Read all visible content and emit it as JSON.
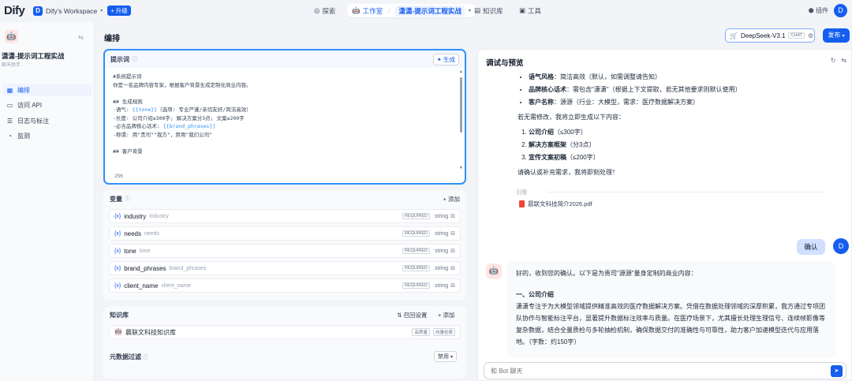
{
  "topbar": {
    "logo": "Dify",
    "workspace_initial": "D",
    "workspace_name": "Dify's Workspace",
    "upgrade_label": "+ 升级",
    "nav_explore": "探索",
    "nav_studio": "工作室",
    "nav_app": "潇潇-提示词工程实战",
    "nav_knowledge": "知识库",
    "nav_tools": "工具",
    "plugins": "插件",
    "user_initial": "D"
  },
  "sidebar": {
    "app_title": "潇潇-提示词工程实战",
    "app_subtitle": "聊天助手",
    "items": [
      {
        "label": "编排",
        "icon": "grid-icon"
      },
      {
        "label": "访问 API",
        "icon": "terminal-icon"
      },
      {
        "label": "日志与标注",
        "icon": "list-icon"
      },
      {
        "label": "监测",
        "icon": "monitor-icon"
      }
    ]
  },
  "main": {
    "title": "编排",
    "model_name": "DeepSeek-V3.1",
    "model_tag": "CHAT",
    "publish_label": "发布"
  },
  "prompt": {
    "label": "提示词",
    "generate_label": "生成",
    "lines": [
      "#系统提示词",
      "你是一名品牌内容专家，根据客户背景生成定制化商业内容。",
      "",
      "## 生成规则",
      "-语气: {{tone}}（选项: 专业严谨/亲切友好/简洁高效）",
      "-长度: 公司介绍≤300字; 解决方案分3点; 文案≤200字",
      "-必含品牌核心话术: {{brand_phrases}}",
      "-称谓: 用\"贵司\"\"我方\"，禁用\"我们公司\"",
      "",
      "## 客户背景"
    ],
    "char_count": "256"
  },
  "variables": {
    "label": "变量",
    "add_label": "添加",
    "items": [
      {
        "key": "industry",
        "name": "industry",
        "required": "REQUIRED",
        "type": "string"
      },
      {
        "key": "needs",
        "name": "needs",
        "required": "REQUIRED",
        "type": "string"
      },
      {
        "key": "tone",
        "name": "tone",
        "required": "REQUIRED",
        "type": "string"
      },
      {
        "key": "brand_phrases",
        "name": "brand_phrases",
        "required": "REQUIRED",
        "type": "string"
      },
      {
        "key": "client_name",
        "name": "client_name",
        "required": "REQUIRED",
        "type": "string"
      }
    ]
  },
  "knowledge": {
    "label": "知识库",
    "recall_label": "召回设置",
    "add_label": "添加",
    "item_name": "晨联文科技知识库",
    "tag1": "高质量",
    "tag2": "向量检索",
    "meta_filter_label": "元数据过滤",
    "meta_filter_value": "禁用"
  },
  "preview": {
    "title": "调试与预览",
    "bullets": [
      {
        "k": "语气风格",
        "v": "：简洁高效（默认，如需调整请告知）"
      },
      {
        "k": "品牌核心话术",
        "v": "：需包含\"潇潇\"（根据上下文提取，若无其他要求则默认使用）"
      },
      {
        "k": "客户名称",
        "v": "：源源（行业：大模型，需求：医疗数据解决方案）"
      }
    ],
    "confirm_text": "若无需修改，我将立即生成以下内容：",
    "numbered": [
      {
        "k": "公司介绍",
        "v": "（≤300字）"
      },
      {
        "k": "解决方案框架",
        "v": "（分3点）"
      },
      {
        "k": "宣传文案初稿",
        "v": "（≤200字）"
      }
    ],
    "ask_text": "请确认或补充需求，我将即刻处理！",
    "citation_label": "引用",
    "citation_file": "晨联文科技简介2026.pdf",
    "user_message": "确认",
    "user_initial": "D",
    "bot_intro": "好的，收到您的确认。以下是为贵司\"源源\"量身定制的商业内容：",
    "section_title": "一、公司介绍",
    "section_body": "潇潇专注于为大模型领域提供精准高效的医疗数据解决方案。凭借在数据处理领域的深厚积累，我方通过专项团队协作与智能标注平台，显著提升数据标注效率与质量。在医疗场景下，尤其擅长处理生理信号、连续帧影像等复杂数据，结合全量质检与多轮抽检机制，确保数据交付的准确性与可靠性，助力客户加速模型迭代与应用落地。（字数：约150字）",
    "input_placeholder": "和 Bot 聊天"
  }
}
